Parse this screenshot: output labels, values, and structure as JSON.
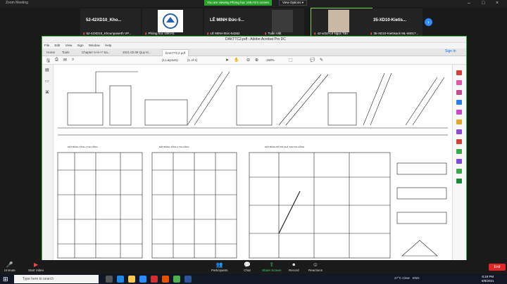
{
  "zoom": {
    "window_title": "Zoom Meeting",
    "banner": "You are viewing Phòng học 108.H1's screen",
    "view_options": "View Options ▾",
    "participants": [
      {
        "name": "52-42XD10_Khounpaserth VP...",
        "big": "52-42XD10_Kho..."
      },
      {
        "name": "Phòng học 108.H1",
        "big": ""
      },
      {
        "name": "LÊ MINH Đức-54262",
        "big": "LÊ MINH Đức-5..."
      },
      {
        "name": "Tuấn Việt",
        "big": ""
      },
      {
        "name": "42-xd10-Lê Ngọc Tân",
        "big": ""
      },
      {
        "name": "35-XD10-Kiettisack ML-50017...",
        "big": "35-XD10-Kietis..."
      }
    ],
    "bottom": {
      "unmute": "Unmute",
      "start_video": "Start Video",
      "participants": "Participants",
      "participants_count": "70",
      "chat": "Chat",
      "share": "Share Screen",
      "record": "Record",
      "reactions": "Reactions",
      "end": "End"
    }
  },
  "acrobat": {
    "title": "DAKTTC2.pdf - Adobe Acrobat Pro DC",
    "menu": [
      "File",
      "Edit",
      "View",
      "Sign",
      "Window",
      "Help"
    ],
    "tabs": [
      "Home",
      "Tools",
      "Chapter 5+6+7 Sa...",
      "2021.02.08 Quy tri...",
      "DAKTTC2.pdf"
    ],
    "sign_in": "Sign In",
    "page": "(1,Layout1)",
    "page_of": "(1 of 1)",
    "zoom": "150%"
  },
  "drawing": {
    "labels": [
      "MẶT BẰNG TẦNG 1 THI CÔNG",
      "MẶT BẰNG TẦNG 2 THI CÔNG",
      "MẶT BẰNG BỐ TRÍ NHÀ TẠM THI CÔNG"
    ]
  },
  "taskbar": {
    "search_placeholder": "Type here to search",
    "weather": "27°C  Clear",
    "lang": "ENG",
    "time": "8:18 PM",
    "date": "8/8/2021"
  }
}
